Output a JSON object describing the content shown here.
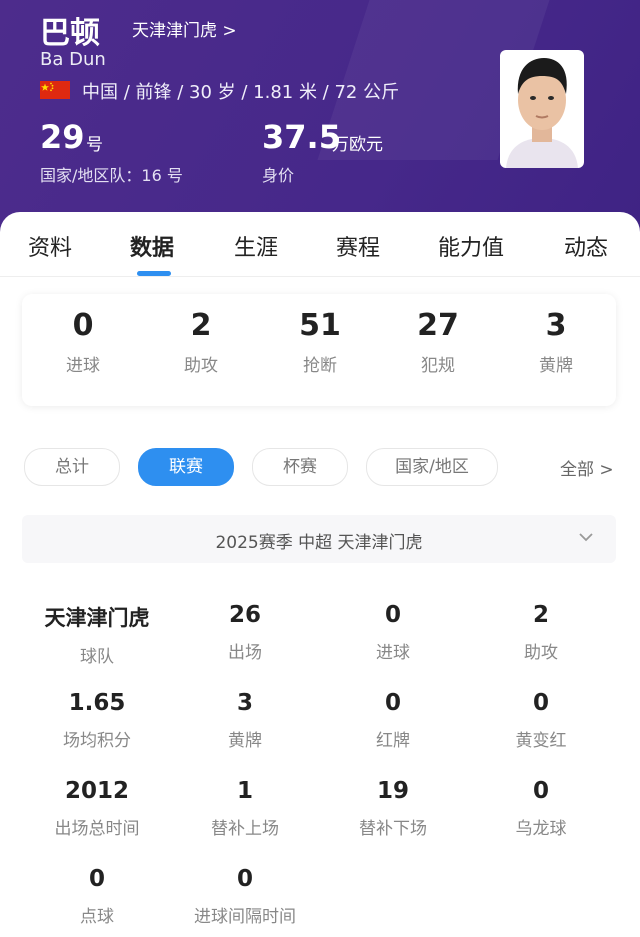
{
  "header": {
    "name": "巴顿",
    "club_link": "天津津门虎 >",
    "english_name": "Ba Dun",
    "flag_icon": "china-flag-icon",
    "bio": "中国 / 前锋 / 30 岁 / 1.81 米 / 72 公斤",
    "shirt_number": "29",
    "shirt_number_unit": "号",
    "national_team": "国家/地区队：16 号",
    "market_value": "37.5",
    "market_value_unit": "万欧元",
    "market_value_label": "身价",
    "colors": {
      "background": "#4a2a87",
      "accent": "#2e8ff0"
    }
  },
  "tabs": [
    {
      "label": "资料"
    },
    {
      "label": "数据"
    },
    {
      "label": "生涯"
    },
    {
      "label": "赛程"
    },
    {
      "label": "能力值"
    },
    {
      "label": "动态"
    }
  ],
  "active_tab": "数据",
  "summary": [
    {
      "value": "0",
      "label": "进球"
    },
    {
      "value": "2",
      "label": "助攻"
    },
    {
      "value": "51",
      "label": "抢断"
    },
    {
      "value": "27",
      "label": "犯规"
    },
    {
      "value": "3",
      "label": "黄牌"
    }
  ],
  "filters": [
    {
      "label": "总计"
    },
    {
      "label": "联赛"
    },
    {
      "label": "杯赛"
    },
    {
      "label": "国家/地区"
    }
  ],
  "active_filter": "联赛",
  "all_link": "全部 >",
  "season_selector": "2025赛季 中超 天津津门虎",
  "stats": [
    {
      "value": "天津津门虎",
      "label": "球队"
    },
    {
      "value": "26",
      "label": "出场"
    },
    {
      "value": "0",
      "label": "进球"
    },
    {
      "value": "2",
      "label": "助攻"
    },
    {
      "value": "1.65",
      "label": "场均积分"
    },
    {
      "value": "3",
      "label": "黄牌"
    },
    {
      "value": "0",
      "label": "红牌"
    },
    {
      "value": "0",
      "label": "黄变红"
    },
    {
      "value": "2012",
      "label": "出场总时间"
    },
    {
      "value": "1",
      "label": "替补上场"
    },
    {
      "value": "19",
      "label": "替补下场"
    },
    {
      "value": "0",
      "label": "乌龙球"
    },
    {
      "value": "0",
      "label": "点球"
    },
    {
      "value": "0",
      "label": "进球间隔时间"
    }
  ]
}
